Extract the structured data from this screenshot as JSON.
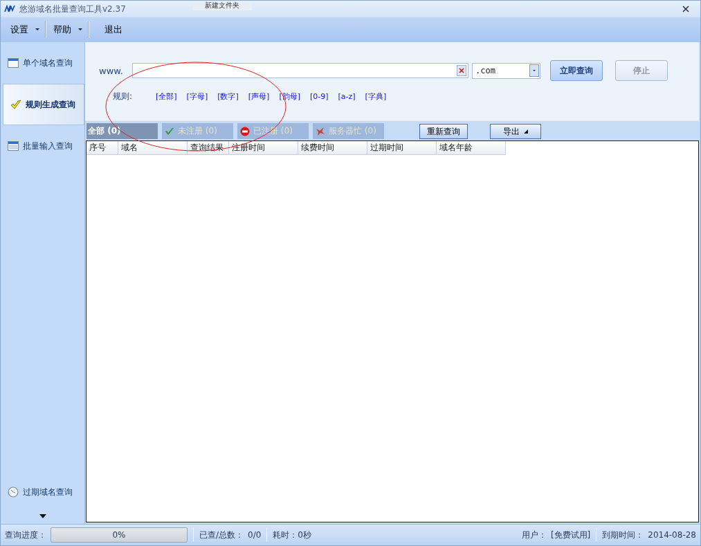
{
  "window": {
    "title": "悠游域名批量查询工具v2.37",
    "overlay_tab": "新建文件夹"
  },
  "menu": [
    {
      "label": "设置",
      "has_dropdown": true
    },
    {
      "label": "帮助",
      "has_dropdown": true
    },
    {
      "label": "退出",
      "has_dropdown": false
    }
  ],
  "sidebar": {
    "items": [
      {
        "label": "单个域名查询",
        "kind": "window",
        "selected": false
      },
      {
        "label": "规则生成查询",
        "kind": "check",
        "selected": true
      },
      {
        "label": "批量输入查询",
        "kind": "list",
        "selected": false
      }
    ],
    "bottom_items": [
      {
        "label": "过期域名查询",
        "kind": "clock",
        "selected": false
      }
    ]
  },
  "query": {
    "prefix": "www.",
    "suffix": ".com",
    "buttons": [
      {
        "label": "立即查询",
        "disabled": false
      },
      {
        "label": "停止",
        "disabled": true
      }
    ]
  },
  "rules": {
    "label": "规则:",
    "options": [
      "[全部]",
      "[字母]",
      "[数字]",
      "[声母]",
      "[韵母]",
      "[0-9]",
      "[a-z]",
      "[字典]"
    ]
  },
  "filters": [
    {
      "label": "全部 (0)",
      "kind": "all",
      "selected": true
    },
    {
      "label": "未注册 (0)",
      "kind": "available",
      "selected": false
    },
    {
      "label": "已注册 (0)",
      "kind": "registered",
      "selected": false
    },
    {
      "label": "服务器忙 (0)",
      "kind": "busy",
      "selected": false
    }
  ],
  "actions": [
    {
      "label": "重新查询",
      "has_dropdown": false
    },
    {
      "label": "导出",
      "has_dropdown": true
    }
  ],
  "table": {
    "columns": [
      "序号",
      "域名",
      "查询结果",
      "注册时间",
      "续费时间",
      "过期时间",
      "域名年龄"
    ]
  },
  "status_bar": {
    "progress_label": "查询进度：",
    "progress": {
      "level": 0,
      "text": "0%"
    },
    "checked_label": "已查/总数：",
    "checked_value": "0/0",
    "elapsed": "耗时：0秒",
    "user_label": "用户：",
    "user_value": "[免费试用]",
    "expiry_label": "到期时间：",
    "expiry_value": "2014-08-28"
  },
  "annotations": [
    {
      "kind": "ellipse",
      "color": "#e02020"
    }
  ]
}
